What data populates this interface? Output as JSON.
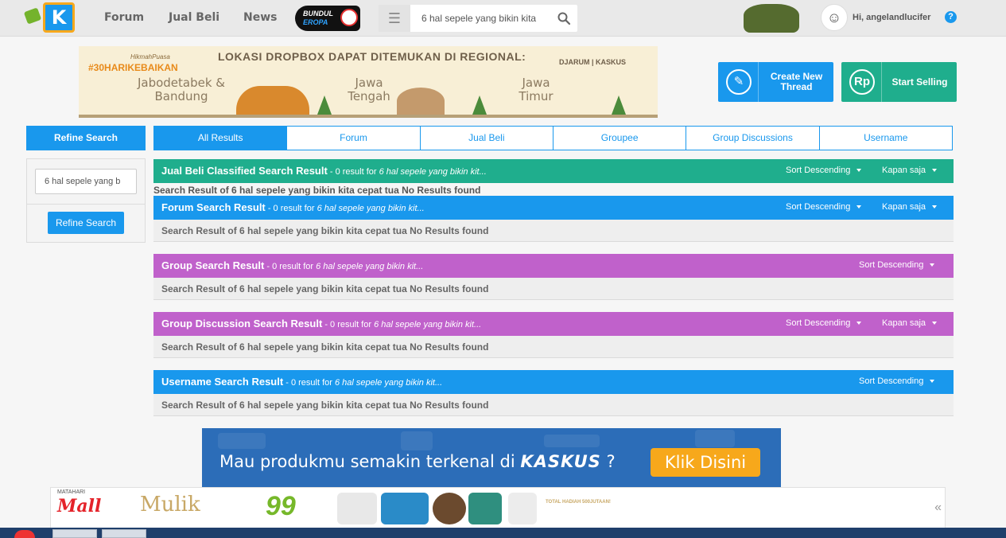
{
  "topnav": {
    "links": [
      "Forum",
      "Jual Beli",
      "News"
    ],
    "bundul": {
      "line1": "BUNDUL",
      "line2": "EROPA"
    },
    "search_value": "6 hal sepele yang bikin kita",
    "greeting": "Hi, angelandlucifer",
    "help": "?"
  },
  "banner": {
    "tag_small": "HikmahPuasa",
    "tag_main": "#30HARIKEBAIKAN",
    "title": "LOKASI DROPBOX DAPAT DITEMUKAN DI REGIONAL:",
    "regions": [
      "Jabodetabek &",
      "Bandung",
      "Jawa",
      "Tengah",
      "Jawa",
      "Timur"
    ],
    "sponsor": "DJARUM | KASKUS"
  },
  "actions": {
    "create_label": "Create New Thread",
    "sell_label": "Start Selling",
    "sell_icon": "Rp"
  },
  "refine": {
    "header": "Refine Search",
    "input_value": "6 hal sepele yang b",
    "button": "Refine Search"
  },
  "tabs": [
    "All Results",
    "Forum",
    "Jual Beli",
    "Groupee",
    "Group Discussions",
    "Username"
  ],
  "results": {
    "query": "6 hal sepele yang bikin kit...",
    "meta": " - 0 result for ",
    "sort_label": "Sort Descending",
    "time_label": "Kapan saja",
    "no_result_text": "Search Result of 6 hal sepele yang bikin kita cepat tua No Results found",
    "sections": [
      {
        "title": "Jual Beli Classified Search Result",
        "color": "#1fae8d"
      },
      {
        "title": "Forum Search Result",
        "color": "#1998ed"
      },
      {
        "title": "Group Search Result",
        "color": "#c061cb"
      },
      {
        "title": "Group Discussion Search Result",
        "color": "#c061cb"
      },
      {
        "title": "Username Search Result",
        "color": "#1998ed"
      }
    ]
  },
  "ad": {
    "text": "Mau produkmu semakin terkenal di",
    "brand": "KASKUS",
    "suffix": "?",
    "cta": "Klik Disini"
  },
  "sticky_ad": {
    "brand_small": "MATAHARI",
    "brand": "Mall",
    "tagline": "Mulik",
    "promo": "99",
    "total": "TOTAL HADIAH 500JUTAAN!",
    "chevron": "«"
  },
  "colors": {
    "primary": "#1998ed",
    "green": "#1fae8d",
    "purple": "#c061cb",
    "accent": "#f7a81b"
  }
}
